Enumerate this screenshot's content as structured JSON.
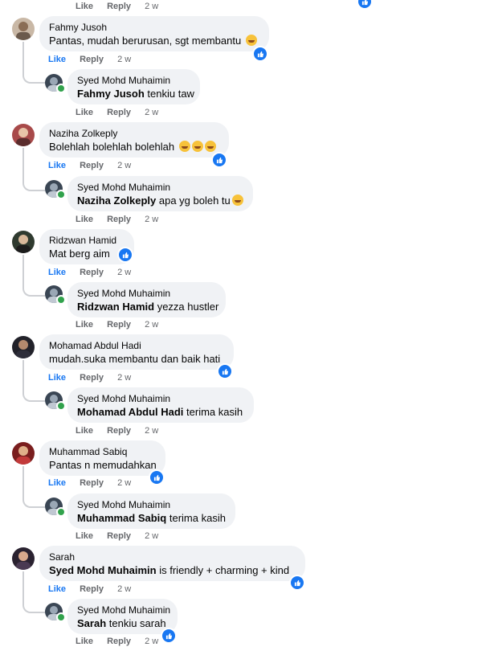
{
  "actions": {
    "like": "Like",
    "reply": "Reply",
    "time": "2 w"
  },
  "top": {
    "like": "Like",
    "reply": "Reply",
    "time": "2 w"
  },
  "comments": [
    {
      "author": "Fahmy Jusoh",
      "text": "Pantas, mudah berurusan, sgt membantu",
      "reply": {
        "author": "Syed Mohd Muhaimin",
        "mention": "Fahmy Jusoh",
        "text": " tenkiu taw"
      }
    },
    {
      "author": "Naziha Zolkeply",
      "text": "Bolehlah bolehlah bolehlah",
      "reply": {
        "author": "Syed Mohd Muhaimin",
        "mention": "Naziha Zolkeply",
        "text": " apa yg boleh tu"
      }
    },
    {
      "author": "Ridzwan Hamid",
      "text": "Mat berg aim",
      "reply": {
        "author": "Syed Mohd Muhaimin",
        "mention": "Ridzwan Hamid",
        "text": " yezza hustler"
      }
    },
    {
      "author": "Mohamad Abdul Hadi",
      "text": "mudah.suka membantu dan baik hati",
      "reply": {
        "author": "Syed Mohd Muhaimin",
        "mention": "Mohamad Abdul Hadi",
        "text": " terima kasih"
      }
    },
    {
      "author": "Muhammad Sabiq",
      "text": "Pantas n memudahkan",
      "reply": {
        "author": "Syed Mohd Muhaimin",
        "mention": "Muhammad Sabiq",
        "text": " terima kasih"
      }
    },
    {
      "author": "Sarah",
      "mention": "Syed Mohd Muhaimin",
      "text": " is friendly + charming + kind",
      "reply": {
        "author": "Syed Mohd Muhaimin",
        "mention": "Sarah",
        "text": " tenkiu sarah"
      }
    }
  ],
  "colors": {
    "bubble": "#f0f2f5",
    "link": "#1877f2",
    "meta": "#65676b",
    "online": "#31a24c"
  }
}
